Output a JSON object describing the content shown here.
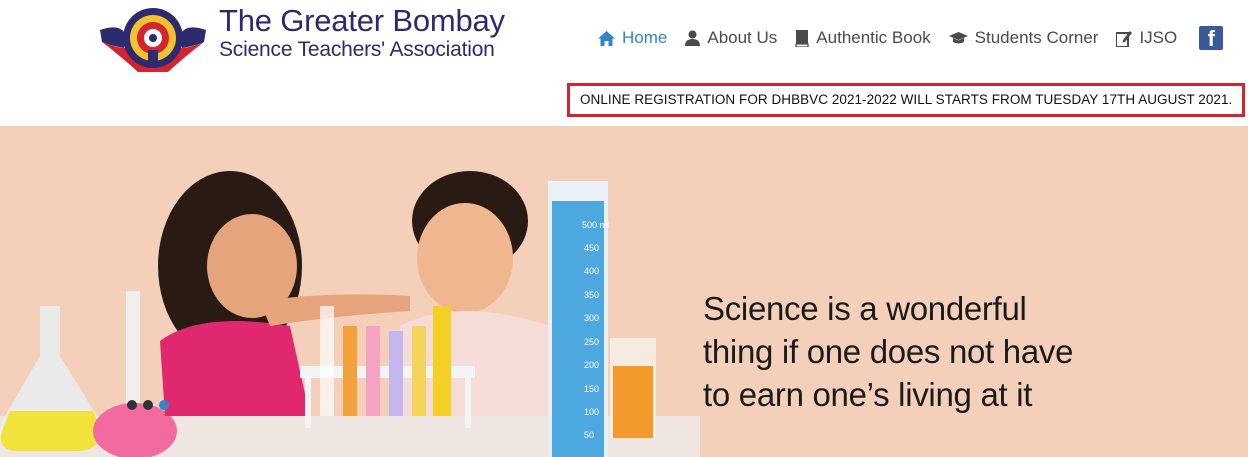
{
  "brand": {
    "title": "The Greater Bombay",
    "subtitle": "Science Teachers' Association"
  },
  "nav": {
    "items": [
      {
        "label": "Home",
        "icon": "home-icon",
        "active": true
      },
      {
        "label": "About Us",
        "icon": "user-icon",
        "active": false
      },
      {
        "label": "Authentic Book",
        "icon": "book-icon",
        "active": false
      },
      {
        "label": "Students Corner",
        "icon": "graduation-cap-icon",
        "active": false
      },
      {
        "label": "IJSO",
        "icon": "edit-icon",
        "active": false
      }
    ],
    "facebook_glyph": "f"
  },
  "announcement": {
    "text": "ONLINE REGISTRATION FOR DHBBVC 2021-2022 WILL STARTS FROM TUESDAY 17TH AUGUST 2021."
  },
  "hero": {
    "quote_lines": [
      "Science is a wonderful",
      "thing if one does not have",
      "to earn one’s living at it"
    ],
    "slides_count": 3,
    "active_slide": 3,
    "cylinder_ticks": [
      "500 ml",
      "450",
      "400",
      "350",
      "300",
      "250",
      "200",
      "150",
      "100",
      "50"
    ]
  },
  "colors": {
    "brand": "#2e2a6e",
    "nav_active": "#2f86c8",
    "announcement_border": "#d32530",
    "hero_bg": "#f4d0ba",
    "facebook": "#3b5998"
  }
}
